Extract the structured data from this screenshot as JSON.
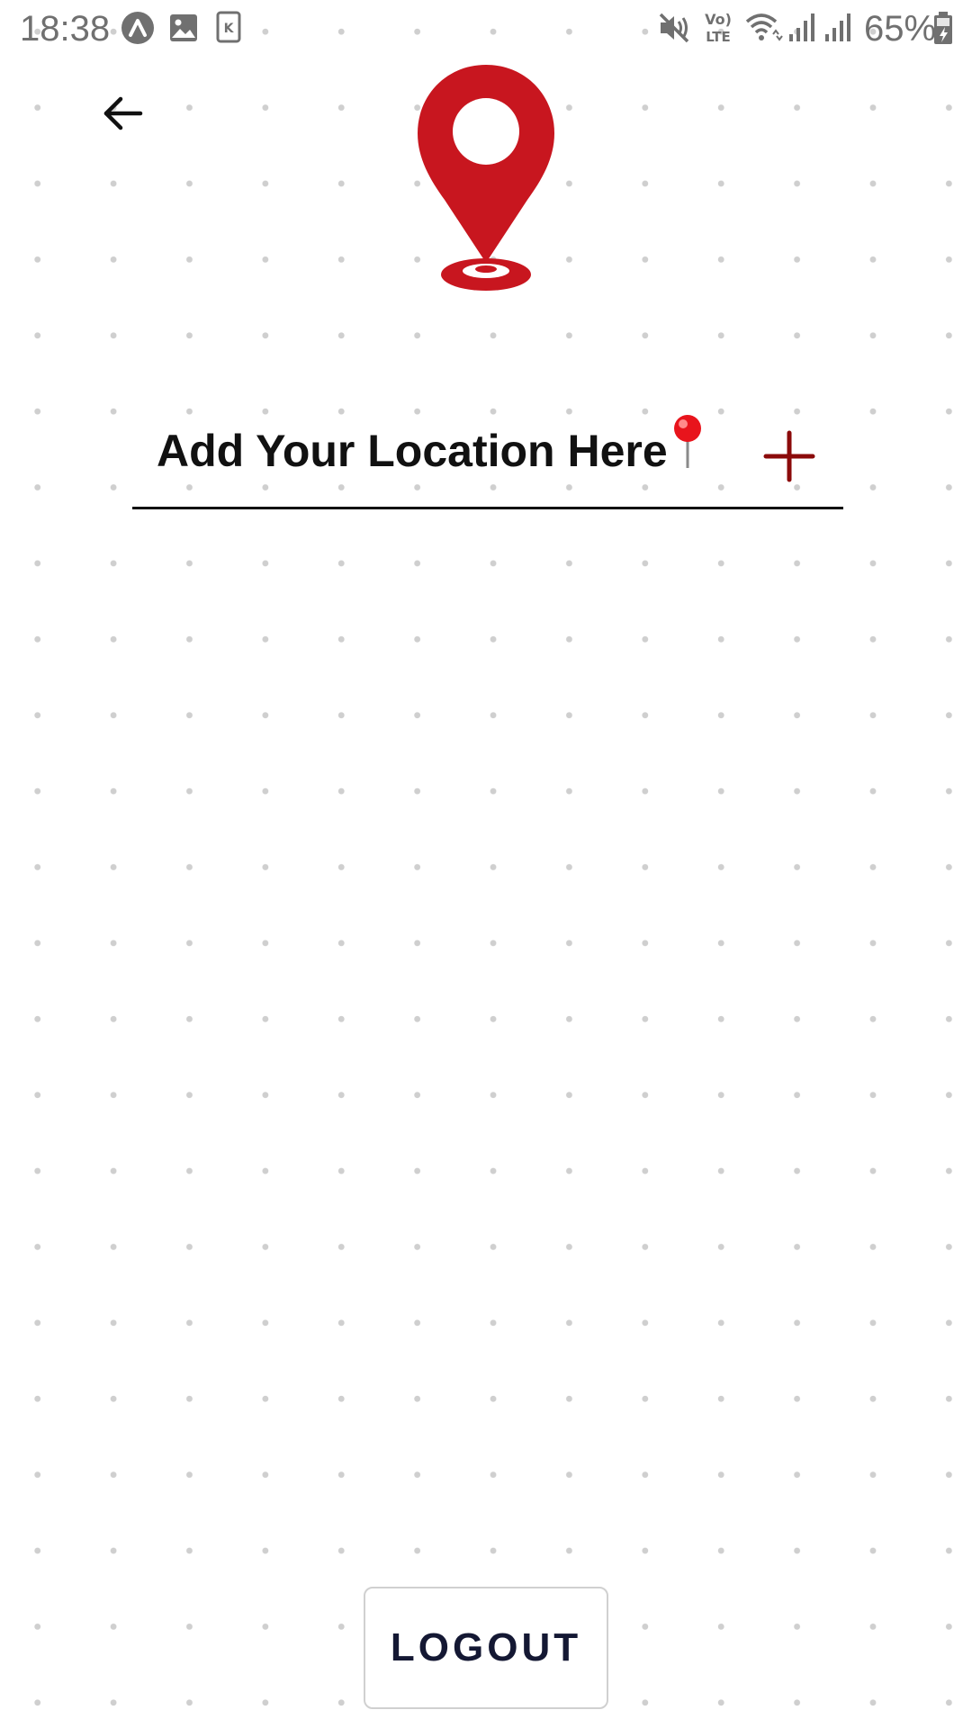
{
  "status_bar": {
    "time": "18:38",
    "battery_percent": "65%",
    "network_label_top": "Vo)",
    "network_label_bottom": "LTE",
    "notification_badge_letter": "K",
    "icons": [
      "app-a-icon",
      "gallery-icon",
      "k-app-icon",
      "mute-icon",
      "volte-icon",
      "wifi-icon",
      "signal-icon",
      "signal-icon",
      "battery-charging-icon"
    ]
  },
  "header": {
    "back_icon": "arrow-left-icon",
    "logo_icon": "location-pin-logo"
  },
  "location": {
    "prompt": "Add Your Location Here",
    "pin_icon": "round-pushpin-icon",
    "add_icon": "plus-icon",
    "add_color": "#8b0a0a"
  },
  "footer": {
    "logout_label": "LOGOUT"
  },
  "colors": {
    "logo_red": "#c8161f",
    "text_dark": "#111111",
    "logout_text": "#141833",
    "underline": "#111111"
  }
}
